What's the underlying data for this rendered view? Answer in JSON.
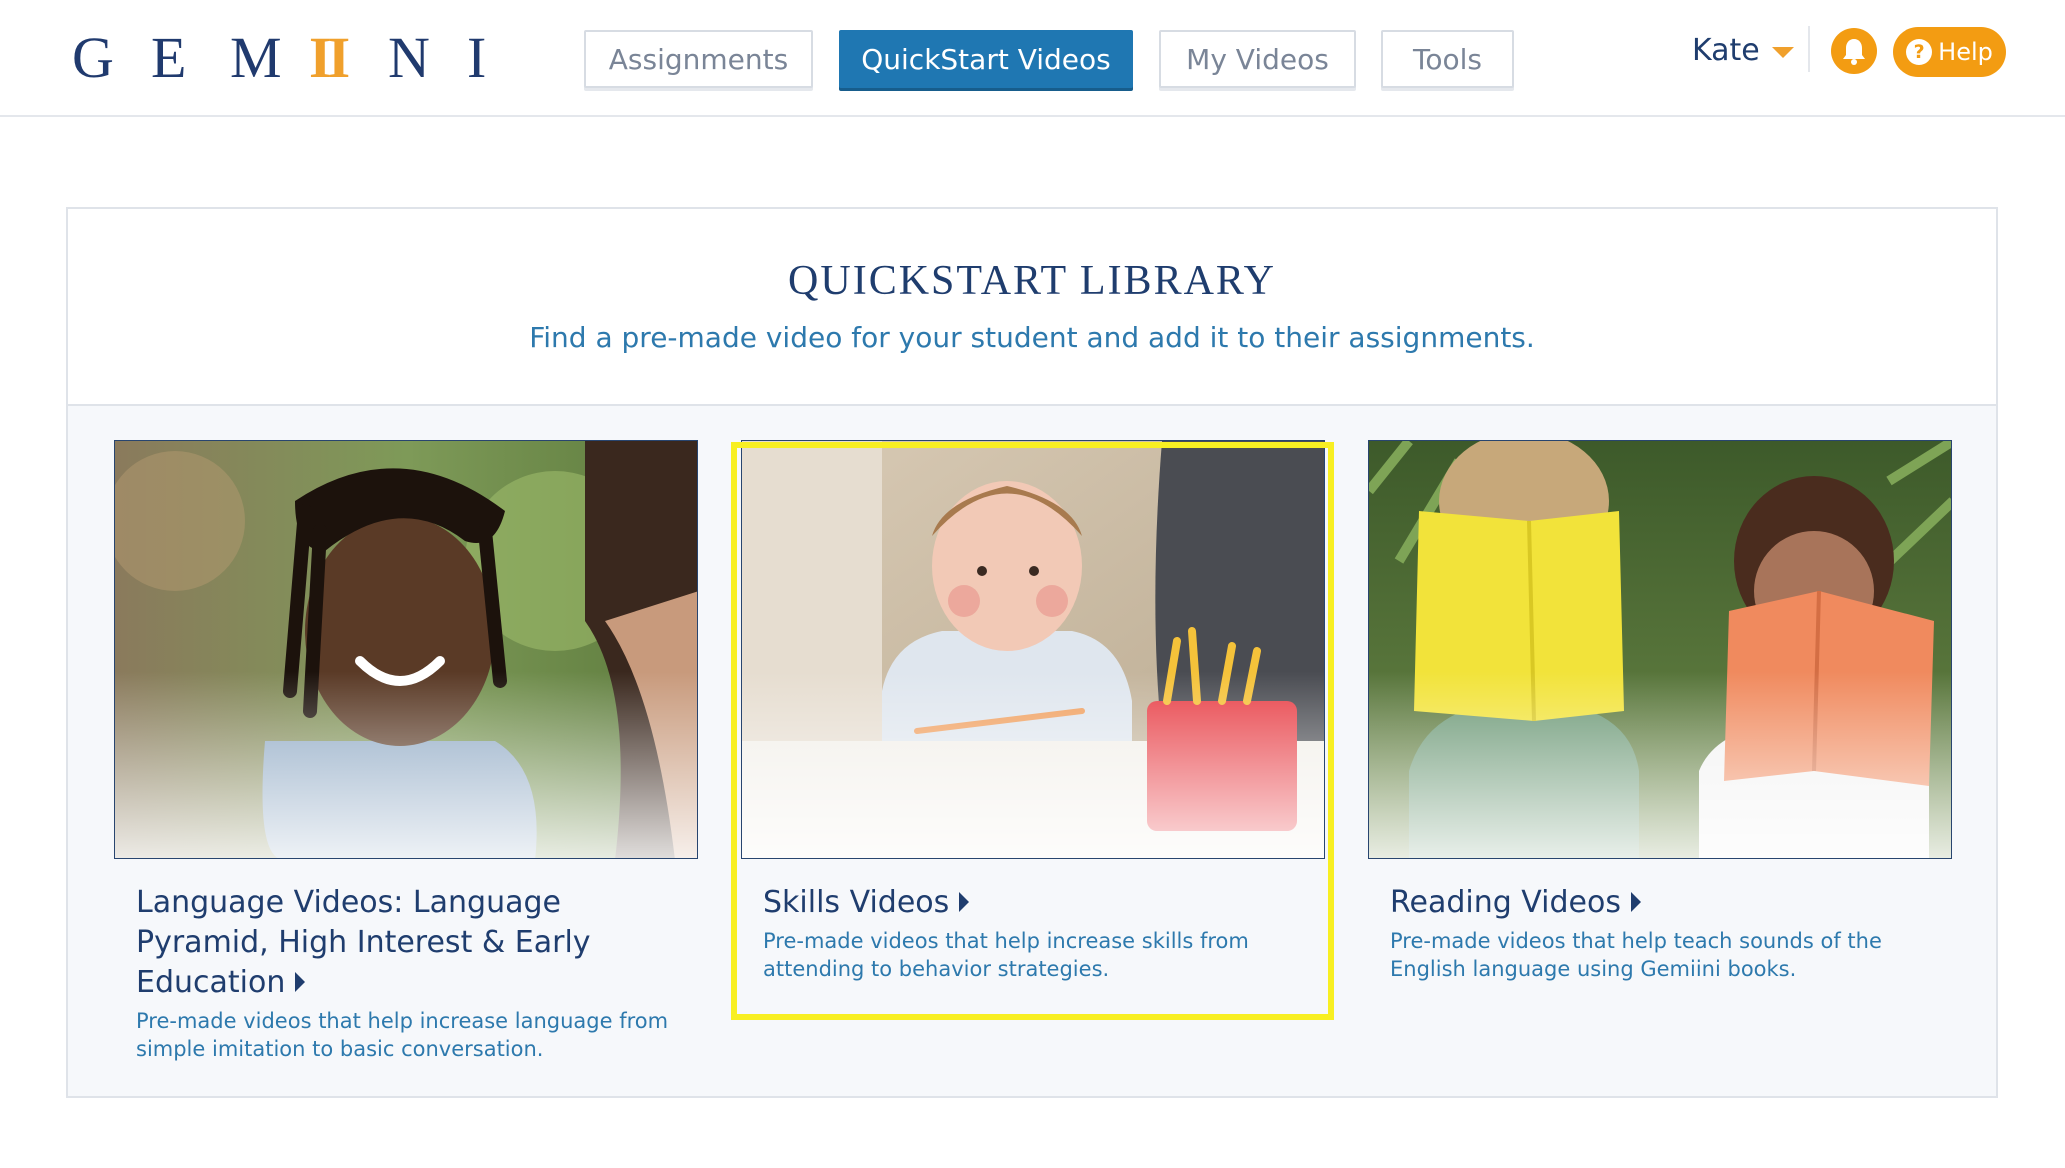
{
  "header": {
    "logo_letters": [
      "G",
      "E",
      "M",
      "II",
      "N",
      "I"
    ],
    "nav": [
      {
        "label": "Assignments",
        "active": false
      },
      {
        "label": "QuickStart Videos",
        "active": true
      },
      {
        "label": "My Videos",
        "active": false
      },
      {
        "label": "Tools",
        "active": false
      }
    ],
    "user_name": "Kate",
    "help_label": "Help",
    "help_icon": "?",
    "bell_icon": "bell-icon"
  },
  "library": {
    "title": "QUICKSTART LIBRARY",
    "subtitle": "Find a pre-made video for your student and add it to their assignments.",
    "cards": [
      {
        "title": "Language Videos: Language Pyramid, High Interest & Early Education",
        "description": "Pre-made videos that help increase language from simple imitation to basic conversation.",
        "highlighted": false
      },
      {
        "title": "Skills Videos",
        "description": "Pre-made videos that help increase skills from attending to behavior strategies.",
        "highlighted": true
      },
      {
        "title": "Reading Videos",
        "description": "Pre-made videos that help teach sounds of the English language using Gemiini books.",
        "highlighted": false
      }
    ]
  },
  "colors": {
    "brand_navy": "#1f3d6e",
    "brand_blue": "#1f77b2",
    "accent_orange": "#f39c12",
    "logo_gold": "#f0a02c",
    "highlight_yellow": "#f8ef22"
  }
}
